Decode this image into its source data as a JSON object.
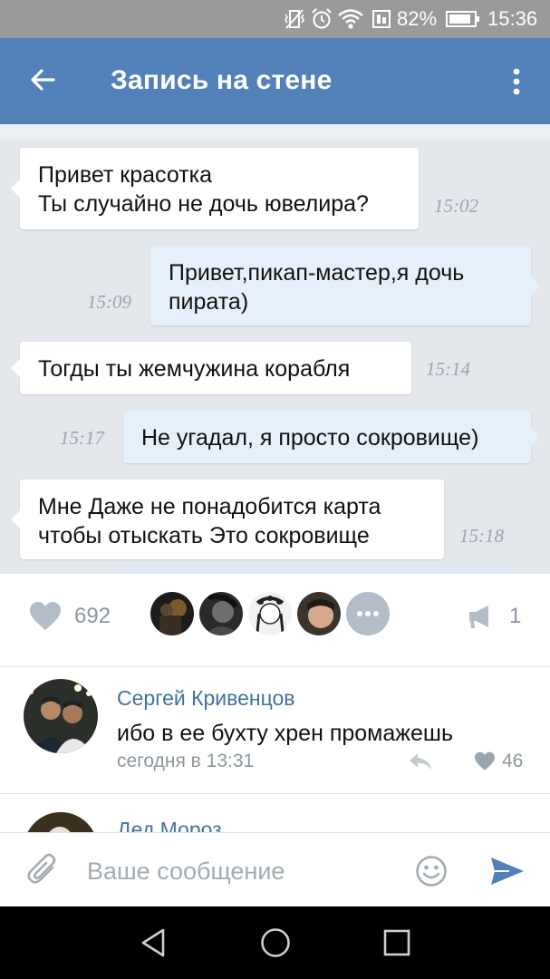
{
  "status_bar": {
    "battery_percent": "82%",
    "time": "15:36"
  },
  "app_bar": {
    "title": "Запись на стене"
  },
  "chat_image": {
    "messages": [
      {
        "direction": "in",
        "text": "Привет красотка\nТы случайно не дочь ювелира?",
        "time": "15:02"
      },
      {
        "direction": "out",
        "text": "Привет,пикап-мастер,я дочь\nпирата)",
        "time": "15:09"
      },
      {
        "direction": "in",
        "text": "Тогды ты жемчужина корабля",
        "time": "15:14"
      },
      {
        "direction": "out",
        "text": "Не угадал, я просто сокровище)",
        "time": "15:17"
      },
      {
        "direction": "in",
        "text": "Мне Даже не понадобится карта\nчтобы отыскать Это сокровище",
        "time": "15:18"
      }
    ]
  },
  "reactions": {
    "likes": "692",
    "shares": "1",
    "liker_avatars": [
      "avatar",
      "avatar",
      "avatar",
      "avatar"
    ]
  },
  "comments": [
    {
      "author": "Сергей Кривенцов",
      "text": "ибо в ее бухту хрен промажешь",
      "date": "сегодня в 13:31",
      "likes": "46"
    },
    {
      "author": "Дед Мороз"
    }
  ],
  "composer": {
    "placeholder": "Ваше сообщение"
  },
  "colors": {
    "app_bar": "#5181b8",
    "link": "#41729f",
    "send": "#5181b8",
    "muted": "#8c96a0"
  },
  "icons": [
    "back-arrow-icon",
    "more-vertical-icon",
    "heart-icon",
    "megaphone-icon",
    "reply-icon",
    "paperclip-icon",
    "smiley-icon",
    "send-icon"
  ]
}
